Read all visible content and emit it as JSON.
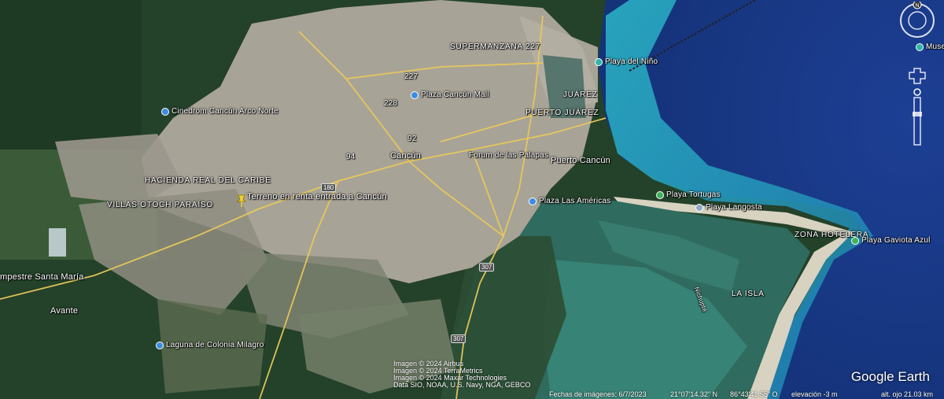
{
  "places": {
    "supermanzana": "SUPERMANZANA 227",
    "playa_nino": "Playa del Niño",
    "museo": "Muse",
    "plaza_mall": "Plaza Cancún Mall",
    "juarez": "JUÁREZ",
    "puerto_juarez": "PUERTO JUÁREZ",
    "cinedrom": "Cinedrom Cancún Arco Norte",
    "cancun": "Cancún",
    "forum": "Forum de las Palapas",
    "puerto_cancun": "Puerto Cancún",
    "hacienda": "HACIENDA REAL DEL CARIBE",
    "villas": "VILLAS OTOCH PARAÍSO",
    "terreno": "Terreno en renta entrada a Cancún",
    "plaza_americas": "Plaza Las Américas",
    "playa_tortugas": "Playa Tortugas",
    "playa_langosta": "Playa Langosta",
    "zona_hotelera": "ZONA HOTELERA",
    "playa_gaviota": "Playa Gaviota Azul",
    "campestre": "mpestre Santa María",
    "avante": "Avante",
    "la_isla": "LA ISLA",
    "nichupte": "Nichupté",
    "laguna": "Laguna de Colonia Milagro"
  },
  "roads": {
    "r227": "227",
    "r228": "228",
    "r92": "92",
    "r94": "94",
    "r180": "180",
    "r307": "307",
    "r307b": "307"
  },
  "credits": {
    "line1": "Imagen © 2024 Airbus",
    "line2": "Imagen © 2024 TerraMetrics",
    "line3": "Imagen © 2024 Maxar Technologies",
    "line4": "Data SIO, NOAA, U.S. Navy, NGA, GEBCO"
  },
  "status": {
    "date": "Fechas de imágenes: 6/7/2023",
    "lat": "21°07'14.32\" N",
    "lon": "86°43'41.55\" O",
    "elev": "elevación  -3 m",
    "eye": "alt. ojo  21.03 km"
  },
  "logo": "Google Earth",
  "nav": {
    "north": "N"
  },
  "colors": {
    "sea_deep": "#1b3f8f",
    "lagoon": "#2e6f6a",
    "city": "#a9a59c",
    "jungle": "#23402a",
    "road": "#e7c85a"
  }
}
